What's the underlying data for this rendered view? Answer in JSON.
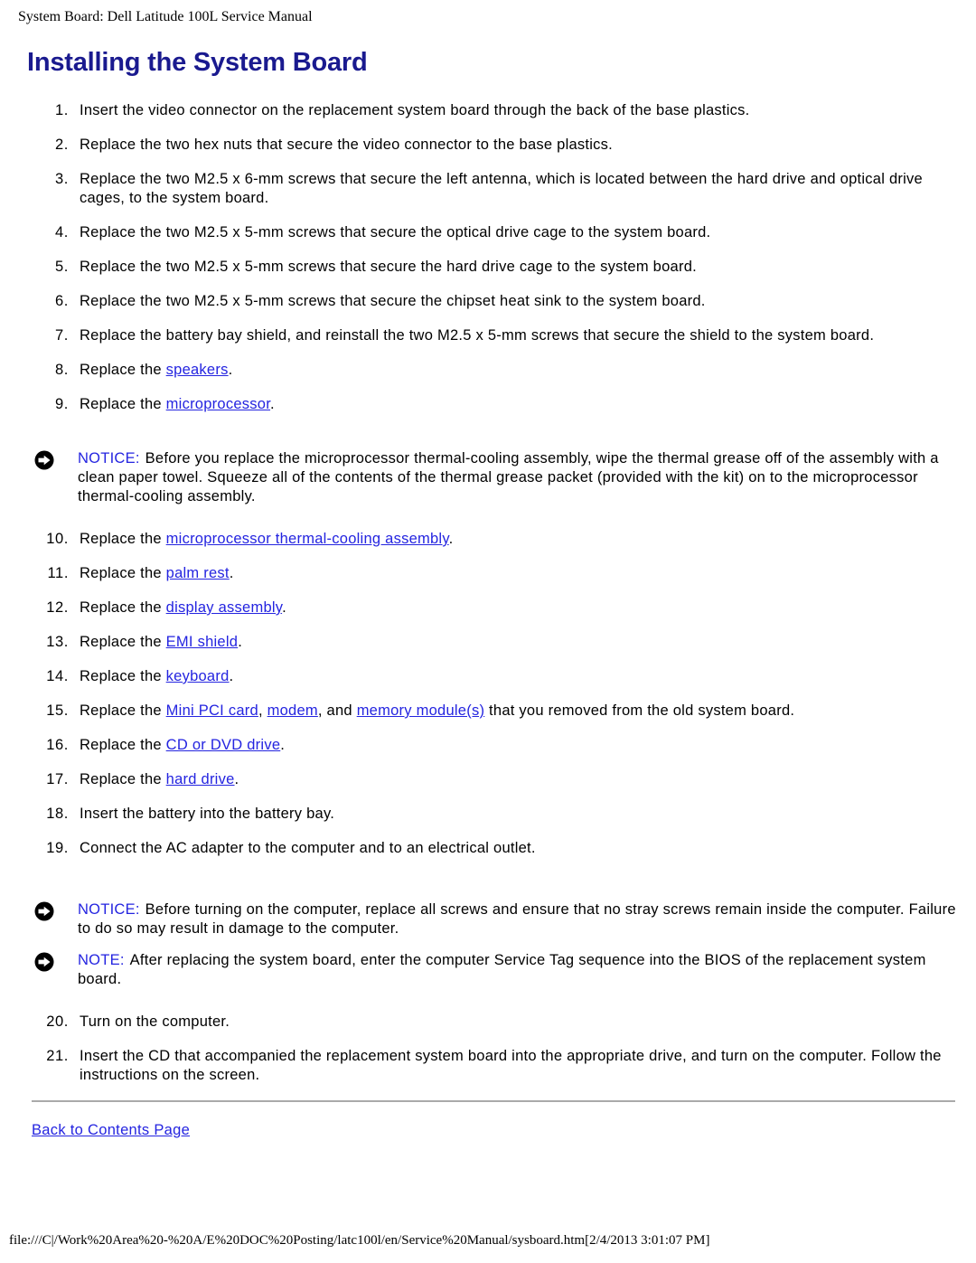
{
  "header": {
    "breadcrumb": "System Board: Dell Latitude 100L Service Manual"
  },
  "page": {
    "title": "Installing the System Board",
    "title_color": "#1a1a8f",
    "link_color": "#2424e0"
  },
  "steps": [
    {
      "num": "1.",
      "parts": [
        {
          "type": "text",
          "text": "Insert the video connector on the replacement system board through the back of the base plastics."
        }
      ]
    },
    {
      "num": "2.",
      "parts": [
        {
          "type": "text",
          "text": "Replace the two hex nuts that secure the video connector to the base plastics."
        }
      ]
    },
    {
      "num": "3.",
      "parts": [
        {
          "type": "text",
          "text": "Replace the two M2.5 x 6-mm screws that secure the left antenna, which is located between the hard drive and optical drive cages, to the system board."
        }
      ]
    },
    {
      "num": "4.",
      "parts": [
        {
          "type": "text",
          "text": "Replace the two M2.5 x 5-mm screws that secure the optical drive cage to the system board."
        }
      ]
    },
    {
      "num": "5.",
      "parts": [
        {
          "type": "text",
          "text": "Replace the two M2.5 x 5-mm screws that secure the hard drive cage to the system board."
        }
      ]
    },
    {
      "num": "6.",
      "parts": [
        {
          "type": "text",
          "text": "Replace the two M2.5 x 5-mm screws that secure the chipset heat sink to the system board."
        }
      ]
    },
    {
      "num": "7.",
      "parts": [
        {
          "type": "text",
          "text": "Replace the battery bay shield, and reinstall the two M2.5 x 5-mm screws that secure the shield to the system board."
        }
      ]
    },
    {
      "num": "8.",
      "parts": [
        {
          "type": "text",
          "text": "Replace the "
        },
        {
          "type": "link",
          "text": "speakers"
        },
        {
          "type": "text",
          "text": "."
        }
      ]
    },
    {
      "num": "9.",
      "parts": [
        {
          "type": "text",
          "text": "Replace the "
        },
        {
          "type": "link",
          "text": "microprocessor"
        },
        {
          "type": "text",
          "text": "."
        }
      ]
    },
    {
      "num": "10.",
      "parts": [
        {
          "type": "text",
          "text": "Replace the "
        },
        {
          "type": "link",
          "text": "microprocessor thermal-cooling assembly"
        },
        {
          "type": "text",
          "text": "."
        }
      ]
    },
    {
      "num": "11.",
      "parts": [
        {
          "type": "text",
          "text": "Replace the "
        },
        {
          "type": "link",
          "text": "palm rest"
        },
        {
          "type": "text",
          "text": "."
        }
      ]
    },
    {
      "num": "12.",
      "parts": [
        {
          "type": "text",
          "text": "Replace the "
        },
        {
          "type": "link",
          "text": "display assembly"
        },
        {
          "type": "text",
          "text": "."
        }
      ]
    },
    {
      "num": "13.",
      "parts": [
        {
          "type": "text",
          "text": "Replace the "
        },
        {
          "type": "link",
          "text": "EMI shield"
        },
        {
          "type": "text",
          "text": "."
        }
      ]
    },
    {
      "num": "14.",
      "parts": [
        {
          "type": "text",
          "text": "Replace the "
        },
        {
          "type": "link",
          "text": "keyboard"
        },
        {
          "type": "text",
          "text": "."
        }
      ]
    },
    {
      "num": "15.",
      "parts": [
        {
          "type": "text",
          "text": "Replace the "
        },
        {
          "type": "link",
          "text": "Mini PCI card"
        },
        {
          "type": "text",
          "text": ", "
        },
        {
          "type": "link",
          "text": "modem"
        },
        {
          "type": "text",
          "text": ", and "
        },
        {
          "type": "link",
          "text": "memory module(s)"
        },
        {
          "type": "text",
          "text": " that you removed from the old system board."
        }
      ]
    },
    {
      "num": "16.",
      "parts": [
        {
          "type": "text",
          "text": "Replace the "
        },
        {
          "type": "link",
          "text": "CD or DVD drive"
        },
        {
          "type": "text",
          "text": "."
        }
      ]
    },
    {
      "num": "17.",
      "parts": [
        {
          "type": "text",
          "text": "Replace the "
        },
        {
          "type": "link",
          "text": "hard drive"
        },
        {
          "type": "text",
          "text": "."
        }
      ]
    },
    {
      "num": "18.",
      "parts": [
        {
          "type": "text",
          "text": "Insert the battery into the battery bay."
        }
      ]
    },
    {
      "num": "19.",
      "parts": [
        {
          "type": "text",
          "text": "Connect the AC adapter to the computer and to an electrical outlet."
        }
      ]
    }
  ],
  "steps_after": [
    {
      "num": "20.",
      "parts": [
        {
          "type": "text",
          "text": "Turn on the computer."
        }
      ]
    },
    {
      "num": "21.",
      "parts": [
        {
          "type": "text",
          "text": "Insert the CD that accompanied the replacement system board into the appropriate drive, and turn on the computer. Follow the instructions on the screen."
        }
      ]
    }
  ],
  "callouts": {
    "notice_1": {
      "icon": "notice-arrow-icon",
      "label": "NOTICE:",
      "body": "Before you replace the microprocessor thermal-cooling assembly, wipe the thermal grease off of the assembly with a clean paper towel. Squeeze all of the contents of the thermal grease packet (provided with the kit) on to the microprocessor thermal-cooling assembly."
    },
    "notice_2": {
      "icon": "notice-arrow-icon",
      "label": "NOTICE:",
      "body": "Before turning on the computer, replace all screws and ensure that no stray screws remain inside the computer. Failure to do so may result in damage to the computer."
    },
    "note_1": {
      "icon": "note-arrow-icon",
      "label": "NOTE:",
      "body": "After replacing the system board, enter the computer Service Tag sequence into the BIOS of the replacement system board."
    }
  },
  "footer": {
    "back_link": "Back to Contents Page",
    "url": "file:///C|/Work%20Area%20-%20A/E%20DOC%20Posting/latc100l/en/Service%20Manual/sysboard.htm[2/4/2013 3:01:07 PM]"
  }
}
